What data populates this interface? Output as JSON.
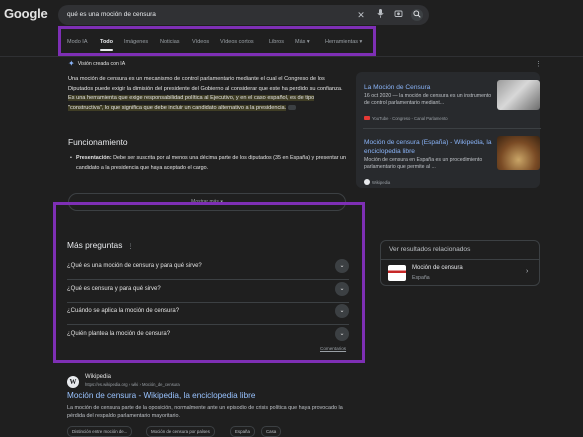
{
  "logo": "Google",
  "search": {
    "query": "qué es una moción de censura",
    "icons": [
      "clear-icon",
      "mic-icon",
      "lens-icon",
      "search-icon"
    ]
  },
  "tabs": [
    "Modo IA",
    "Todo",
    "Imágenes",
    "Noticias",
    "Vídeos",
    "Vídeos cortos",
    "Libros",
    "Más ▾",
    "Herramientas ▾"
  ],
  "active_tab": "Todo",
  "ai_overview": {
    "header": "Visión creada con IA",
    "paragraph_plain": "Una moción de censura es un mecanismo de control parlamentario mediante el cual el Congreso de los Diputados puede exigir la dimisión del presidente del Gobierno al considerar que este ha perdido su confianza. ",
    "paragraph_highlight": "Es una herramienta que exige responsabilidad política al Ejecutivo, y en el caso español, es de tipo \"constructiva\", lo que significa que debe incluir un candidato alternativo a la presidencia.",
    "section_title": "Funcionamiento",
    "item_label": "Presentación:",
    "item_text": " Debe ser suscrita por al menos una décima parte de los diputados (35 en España) y presentar un candidato a la presidencia que haya aceptado el cargo.",
    "show_more": "Mostrar más ▾"
  },
  "sources": [
    {
      "title": "La Moción de Censura",
      "snippet": "16 oct 2020 — la moción de censura es un instrumento de control parlamentario mediant...",
      "meta": "YouTube · Congreso - Canal Parlamento"
    },
    {
      "title": "Moción de censura (España) - Wikipedia, la enciclopedia libre",
      "snippet": "Moción de censura en España es un procedimiento parlamentario que permite al ...",
      "meta": "Wikipedia"
    }
  ],
  "paa": {
    "title": "Más preguntas",
    "info": "⋮",
    "questions": [
      "¿Qué es una moción de censura y para qué sirve?",
      "¿Qué es censura y para qué sirve?",
      "¿Cuándo se aplica la moción de censura?",
      "¿Quién plantea la moción de censura?"
    ],
    "feedback": "Comentarios"
  },
  "related": {
    "header": "Ver resultados relacionados",
    "title": "Moción de censura",
    "subtitle": "España"
  },
  "result": {
    "icon_letter": "W",
    "site": "Wikipedia",
    "url": "https://es.wikipedia.org › wiki › Moción_de_censura",
    "title": "Moción de censura - Wikipedia, la enciclopedia libre",
    "snippet": "La moción de censura parte de la oposición, normalmente ante un episodio de crisis política que haya provocado la pérdida del respaldo parlamentario mayoritario.",
    "chips": [
      "Distinción entre moción de...",
      "Moción de censura por países",
      "España",
      "Casa"
    ]
  },
  "colors": {
    "background": "#1f1f1f",
    "link": "#99c3ff",
    "annotation": "#7e2fb5"
  }
}
